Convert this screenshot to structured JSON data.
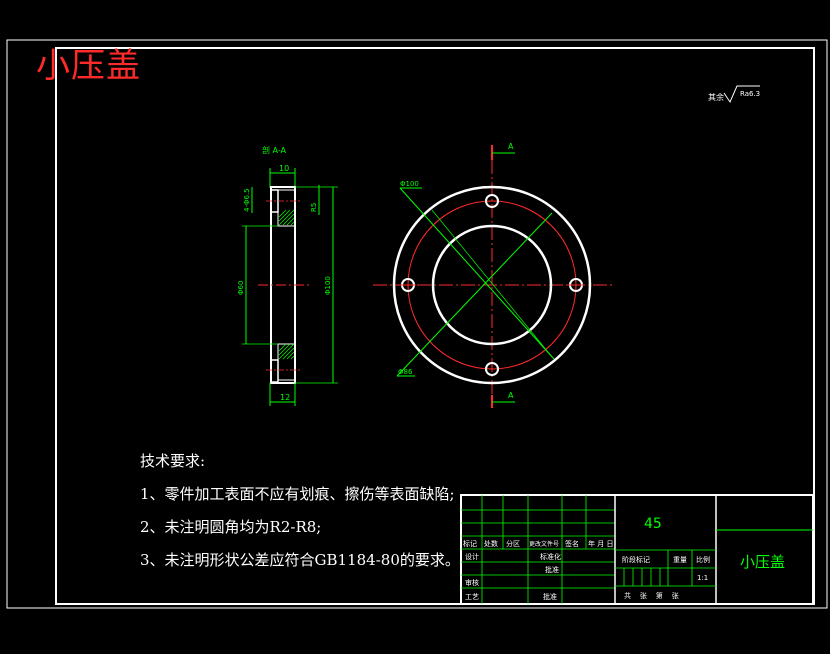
{
  "big_title": "小压盖",
  "roughness_note": {
    "prefix": "其余",
    "value": "Ra6.3"
  },
  "section_label": "剖 A-A",
  "section_marker": "A",
  "dimensions": {
    "side_top_width": "10",
    "side_bottom_width": "12",
    "hole_dia": "4-Φ6.5",
    "bore_dia": "Φ60",
    "outer_dia": "Φ100",
    "inner_ref": "R5",
    "front_outer": "Φ100",
    "front_pcd": "Φ86"
  },
  "technical_requirements": {
    "heading": "技术要求:",
    "items": [
      "1、零件加工表面不应有划痕、擦伤等表面缺陷;",
      "2、未注明圆角均为R2-R8;",
      "3、未注明形状公差应符合GB1184-80的要求。"
    ]
  },
  "title_block": {
    "material": "45",
    "part_name": "小压盖",
    "rev_headers": [
      "标记",
      "处数",
      "分区",
      "更改文件号",
      "签名",
      "年 月 日"
    ],
    "roles": [
      "设计",
      "审核",
      "工艺"
    ],
    "role_cols": [
      "标准化",
      "批准"
    ],
    "standardization": "标准化",
    "approve": "批准",
    "stage_headers": [
      "阶段标记",
      "重量",
      "比例"
    ],
    "scale": "1:1",
    "sheet_footer": "共    张    第    张"
  }
}
